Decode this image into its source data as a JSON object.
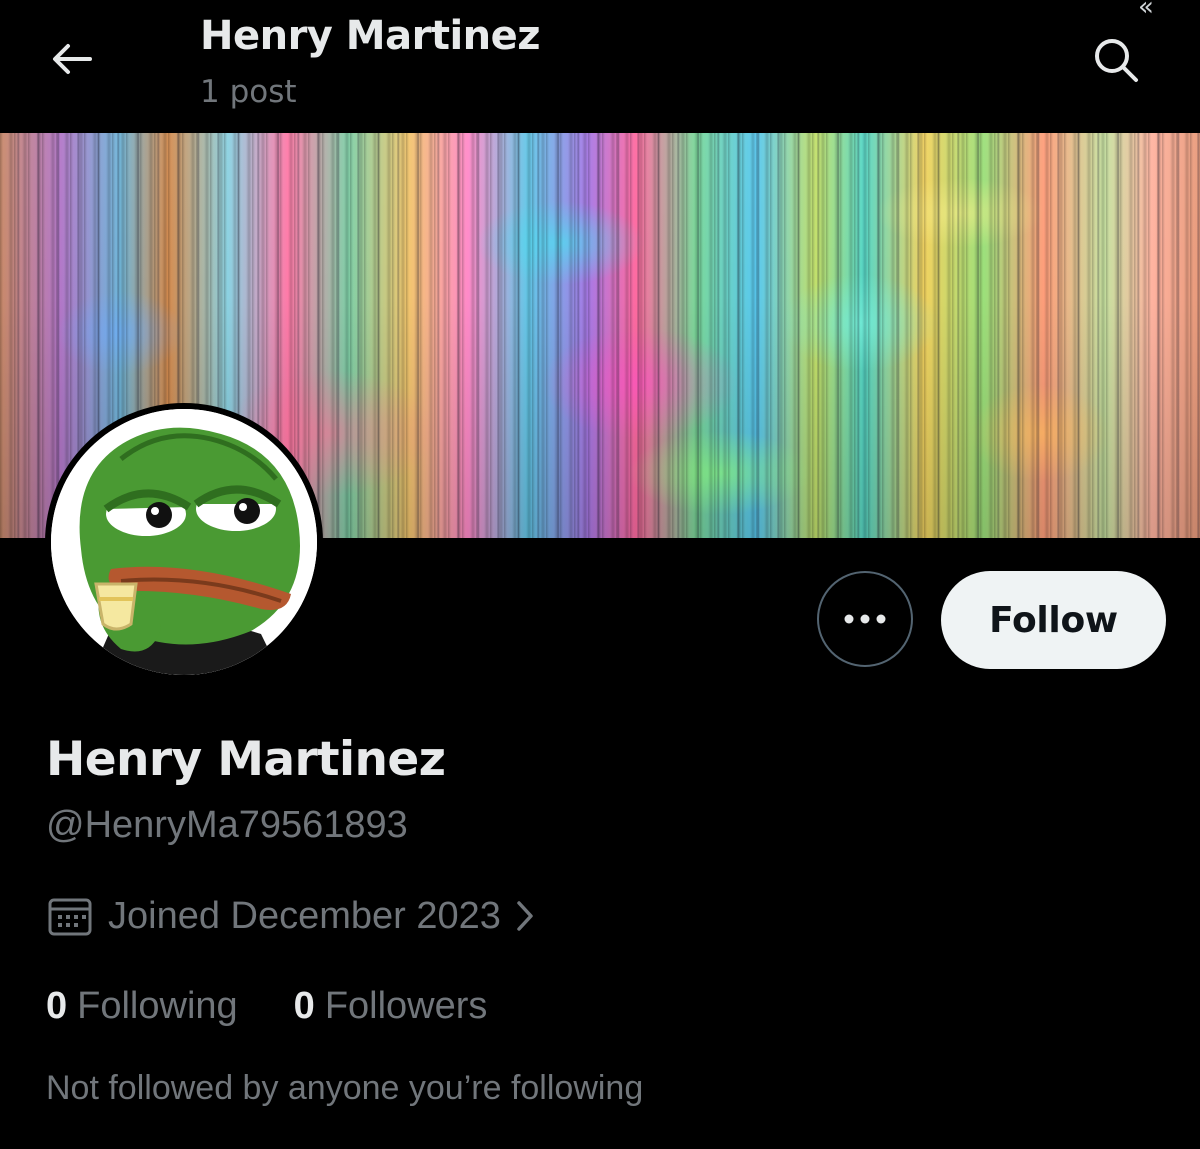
{
  "header": {
    "name": "Henry Martinez",
    "post_count": "1 post",
    "back_icon": "arrow-left-icon",
    "search_icon": "search-icon",
    "corner_glyph": "«"
  },
  "profile": {
    "display_name": "Henry Martinez",
    "handle": "@HenryMa79561893",
    "joined": "Joined December 2023",
    "joined_icon": "calendar-icon",
    "following_count": "0",
    "following_label": "Following",
    "followers_count": "0",
    "followers_label": "Followers",
    "mutuals_note": "Not followed by anyone you’re following"
  },
  "actions": {
    "more_icon": "more-options-icon",
    "follow_label": "Follow"
  },
  "colors": {
    "background": "#000000",
    "primary_text": "#e7e9ea",
    "secondary_text": "#71767b",
    "follow_button_bg": "#eff3f4",
    "follow_button_text": "#0f1419",
    "border": "#536471"
  }
}
